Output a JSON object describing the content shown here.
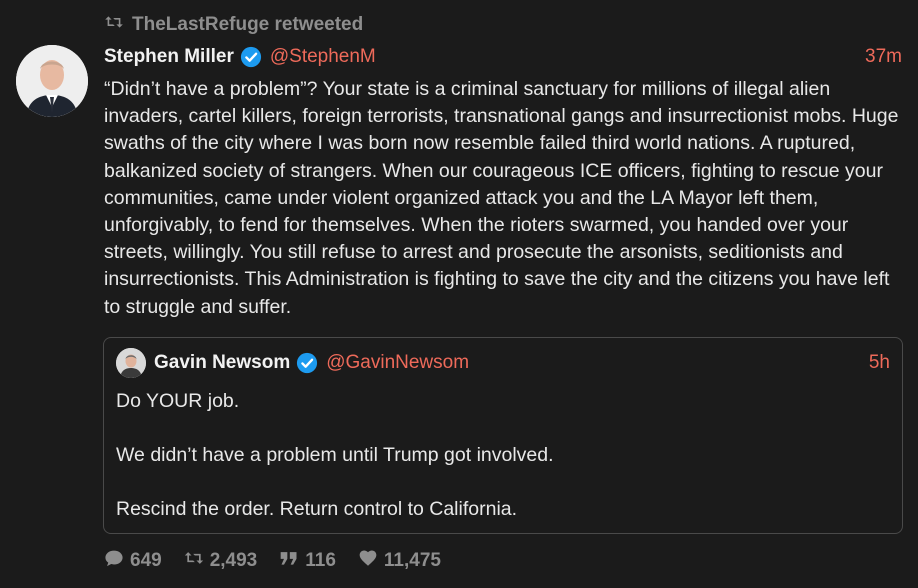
{
  "retweet": {
    "label": "TheLastRefuge retweeted",
    "icon": "retweet-icon"
  },
  "tweet": {
    "name": "Stephen Miller",
    "handle": "@StephenM",
    "time": "37m",
    "text": "“Didn’t have a problem”? Your state is a criminal sanctuary for millions of illegal alien invaders, cartel killers, foreign terrorists, transnational gangs and insurrectionist mobs. Huge swaths of the city where I was born now resemble failed third world nations. A ruptured, balkanized society of strangers. When our courageous ICE officers, fighting to rescue your communities, came under violent organized attack you and the LA Mayor left them, unforgivably, to fend for themselves. When the rioters swarmed, you handed over your streets, willingly. You still refuse to arrest and prosecute the arsonists, seditionists and insurrectionists. This Administration is fighting to save the city and the citizens you have left to struggle and suffer."
  },
  "quote": {
    "name": "Gavin Newsom",
    "handle": "@GavinNewsom",
    "time": "5h",
    "lines": [
      "Do YOUR job.",
      "We didn’t have a problem until Trump got involved.",
      "Rescind the order. Return control to California."
    ]
  },
  "actions": {
    "replies": "649",
    "retweets": "2,493",
    "quotes": "116",
    "likes": "11,475"
  },
  "colors": {
    "accent": "#ee6a5a",
    "verified": "#1d9bf0",
    "muted": "#8e8e8e",
    "background": "#1b1b1b"
  }
}
